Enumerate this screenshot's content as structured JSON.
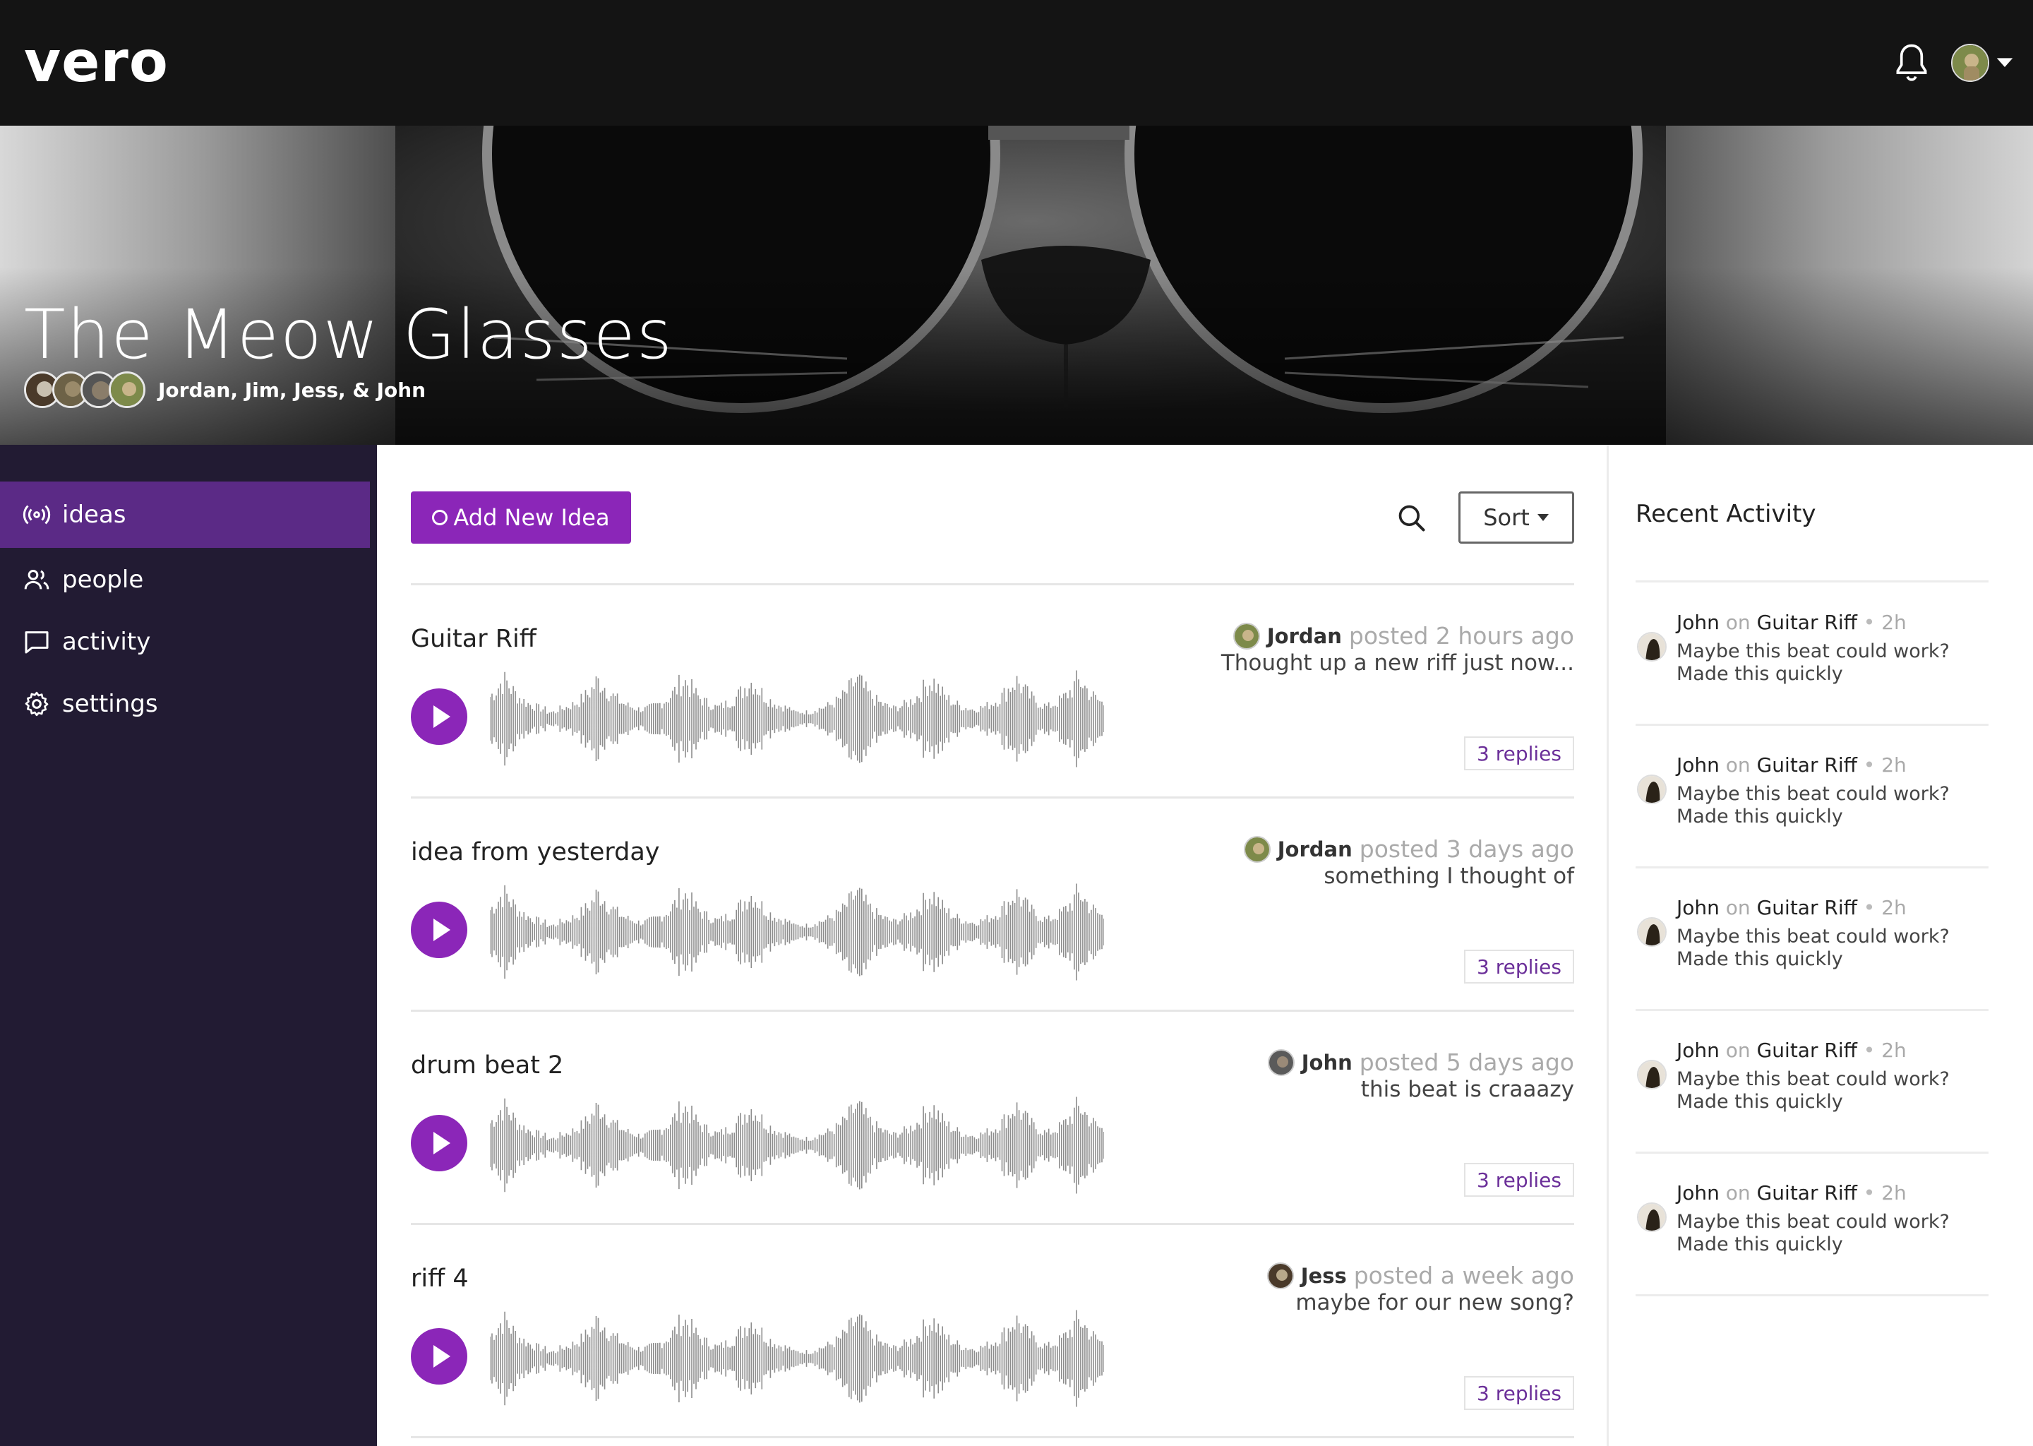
{
  "app": {
    "logo": "vero"
  },
  "topbar": {
    "bell_icon": "bell-icon",
    "avatar_icon": "user-avatar",
    "caret_icon": "caret-down-icon"
  },
  "hero": {
    "title": "The Meow Glasses",
    "members": "Jordan, Jim, Jess, & John",
    "member_avatar_count": 4
  },
  "sidebar": {
    "items": [
      {
        "label": "ideas",
        "icon": "broadcast-icon",
        "active": true
      },
      {
        "label": "people",
        "icon": "people-icon",
        "active": false
      },
      {
        "label": "activity",
        "icon": "chat-bubble-icon",
        "active": false
      },
      {
        "label": "settings",
        "icon": "gear-icon",
        "active": false
      }
    ]
  },
  "toolbar": {
    "add_label": "Add New Idea",
    "sort_label": "Sort",
    "search_icon": "search-icon"
  },
  "ideas": [
    {
      "title": "Guitar Riff",
      "author": "Jordan",
      "time": "posted 2 hours ago",
      "desc": "Thought up a new riff just now...",
      "replies": "3 replies"
    },
    {
      "title": "idea from yesterday",
      "author": "Jordan",
      "time": "posted 3 days ago",
      "desc": "something I thought of",
      "replies": "3 replies"
    },
    {
      "title": "drum beat 2",
      "author": "John",
      "time": "posted 5 days ago",
      "desc": "this beat is craaazy",
      "replies": "3 replies"
    },
    {
      "title": "riff 4",
      "author": "Jess",
      "time": "posted a week ago",
      "desc": "maybe for our new song?",
      "replies": "3 replies"
    }
  ],
  "recent": {
    "title": "Recent Activity",
    "items": [
      {
        "user": "John",
        "on": "on",
        "target": "Guitar Riff",
        "dot": "•",
        "time": "2h",
        "body": "Maybe this beat could work? Made this quickly"
      },
      {
        "user": "John",
        "on": "on",
        "target": "Guitar Riff",
        "dot": "•",
        "time": "2h",
        "body": "Maybe this beat could work? Made this quickly"
      },
      {
        "user": "John",
        "on": "on",
        "target": "Guitar Riff",
        "dot": "•",
        "time": "2h",
        "body": "Maybe this beat could work? Made this quickly"
      },
      {
        "user": "John",
        "on": "on",
        "target": "Guitar Riff",
        "dot": "•",
        "time": "2h",
        "body": "Maybe this beat could work? Made this quickly"
      },
      {
        "user": "John",
        "on": "on",
        "target": "Guitar Riff",
        "dot": "•",
        "time": "2h",
        "body": "Maybe this beat could work? Made this quickly"
      }
    ]
  },
  "colors": {
    "accent": "#8b26b8",
    "sidebar_bg": "#221b33",
    "sidebar_active": "#5b2a86",
    "topbar_bg": "#141414",
    "reply_text": "#6b2f99"
  }
}
